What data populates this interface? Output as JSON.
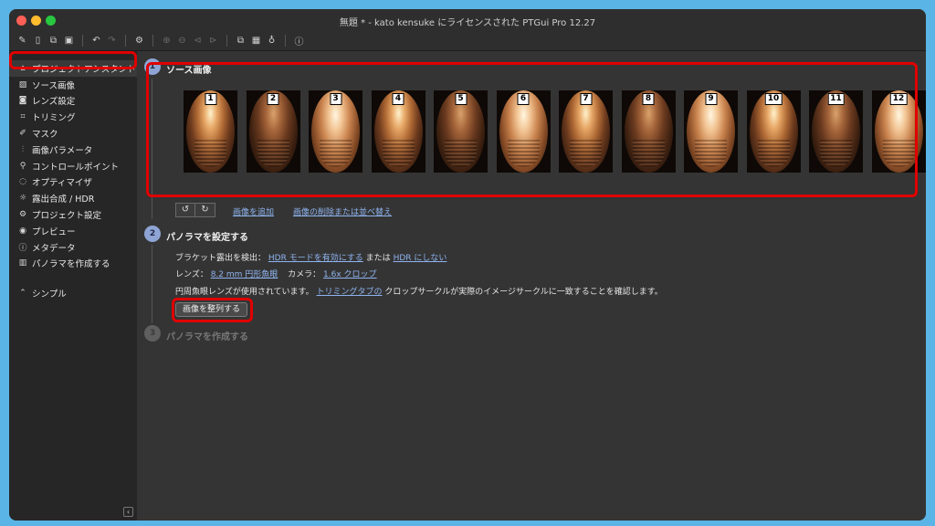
{
  "window": {
    "title": "無題 * - kato kensuke にライセンスされた PTGui Pro 12.27"
  },
  "toolbar": {
    "icons": [
      "new-project-icon",
      "open-icon",
      "copy-icon",
      "save-icon",
      "undo-icon",
      "redo-icon",
      "settings-icon",
      "zoom-in-icon",
      "zoom-out-icon",
      "prev-icon",
      "next-icon",
      "panorama-editor-icon",
      "table-icon",
      "lightbulb-icon",
      "help-icon"
    ]
  },
  "sidebar": {
    "items": [
      {
        "label": "プロジェクトアシスタント",
        "icon": "home-icon"
      },
      {
        "label": "ソース画像",
        "icon": "image-icon"
      },
      {
        "label": "レンズ設定",
        "icon": "camera-icon"
      },
      {
        "label": "トリミング",
        "icon": "crop-icon"
      },
      {
        "label": "マスク",
        "icon": "brush-icon"
      },
      {
        "label": "画像パラメータ",
        "icon": "sliders-icon"
      },
      {
        "label": "コントロールポイント",
        "icon": "control-points-icon"
      },
      {
        "label": "オプティマイザ",
        "icon": "optimizer-icon"
      },
      {
        "label": "露出合成 / HDR",
        "icon": "sun-icon"
      },
      {
        "label": "プロジェクト設定",
        "icon": "gear-icon"
      },
      {
        "label": "プレビュー",
        "icon": "eye-icon"
      },
      {
        "label": "メタデータ",
        "icon": "info-icon"
      },
      {
        "label": "パノラマを作成する",
        "icon": "panorama-icon"
      }
    ],
    "simple_label": "シンプル",
    "collapse_glyph": "‹"
  },
  "steps": {
    "step1": {
      "num": "1",
      "title": "ソース画像"
    },
    "step2": {
      "num": "2",
      "title": "パノラマを設定する"
    },
    "step3": {
      "num": "3",
      "title": "パノラマを作成する"
    }
  },
  "images": [
    "1",
    "2",
    "3",
    "4",
    "5",
    "6",
    "7",
    "8",
    "9",
    "10",
    "11",
    "12"
  ],
  "actions": {
    "add_images": "画像を追加",
    "remove_or_reorder": "画像の削除または並べ替え",
    "rotate_left": "↺",
    "rotate_right": "↻"
  },
  "config": {
    "bracket_label": "ブラケット露出を検出：",
    "hdr_enable": "HDR モードを有効にする",
    "or_text": "または",
    "hdr_disable": "HDR にしない",
    "lens_label": "レンズ：",
    "lens_value": "8.2 mm 円形魚眼",
    "camera_label": "カメラ：",
    "camera_value": "1.6x クロップ",
    "fisheye_note_pre": "円周魚眼レンズが使用されています。",
    "fisheye_link": "トリミングタブの",
    "fisheye_note_post": "クロップサークルが実際のイメージサークルに一致することを確認します。",
    "align_button": "画像を整列する"
  }
}
